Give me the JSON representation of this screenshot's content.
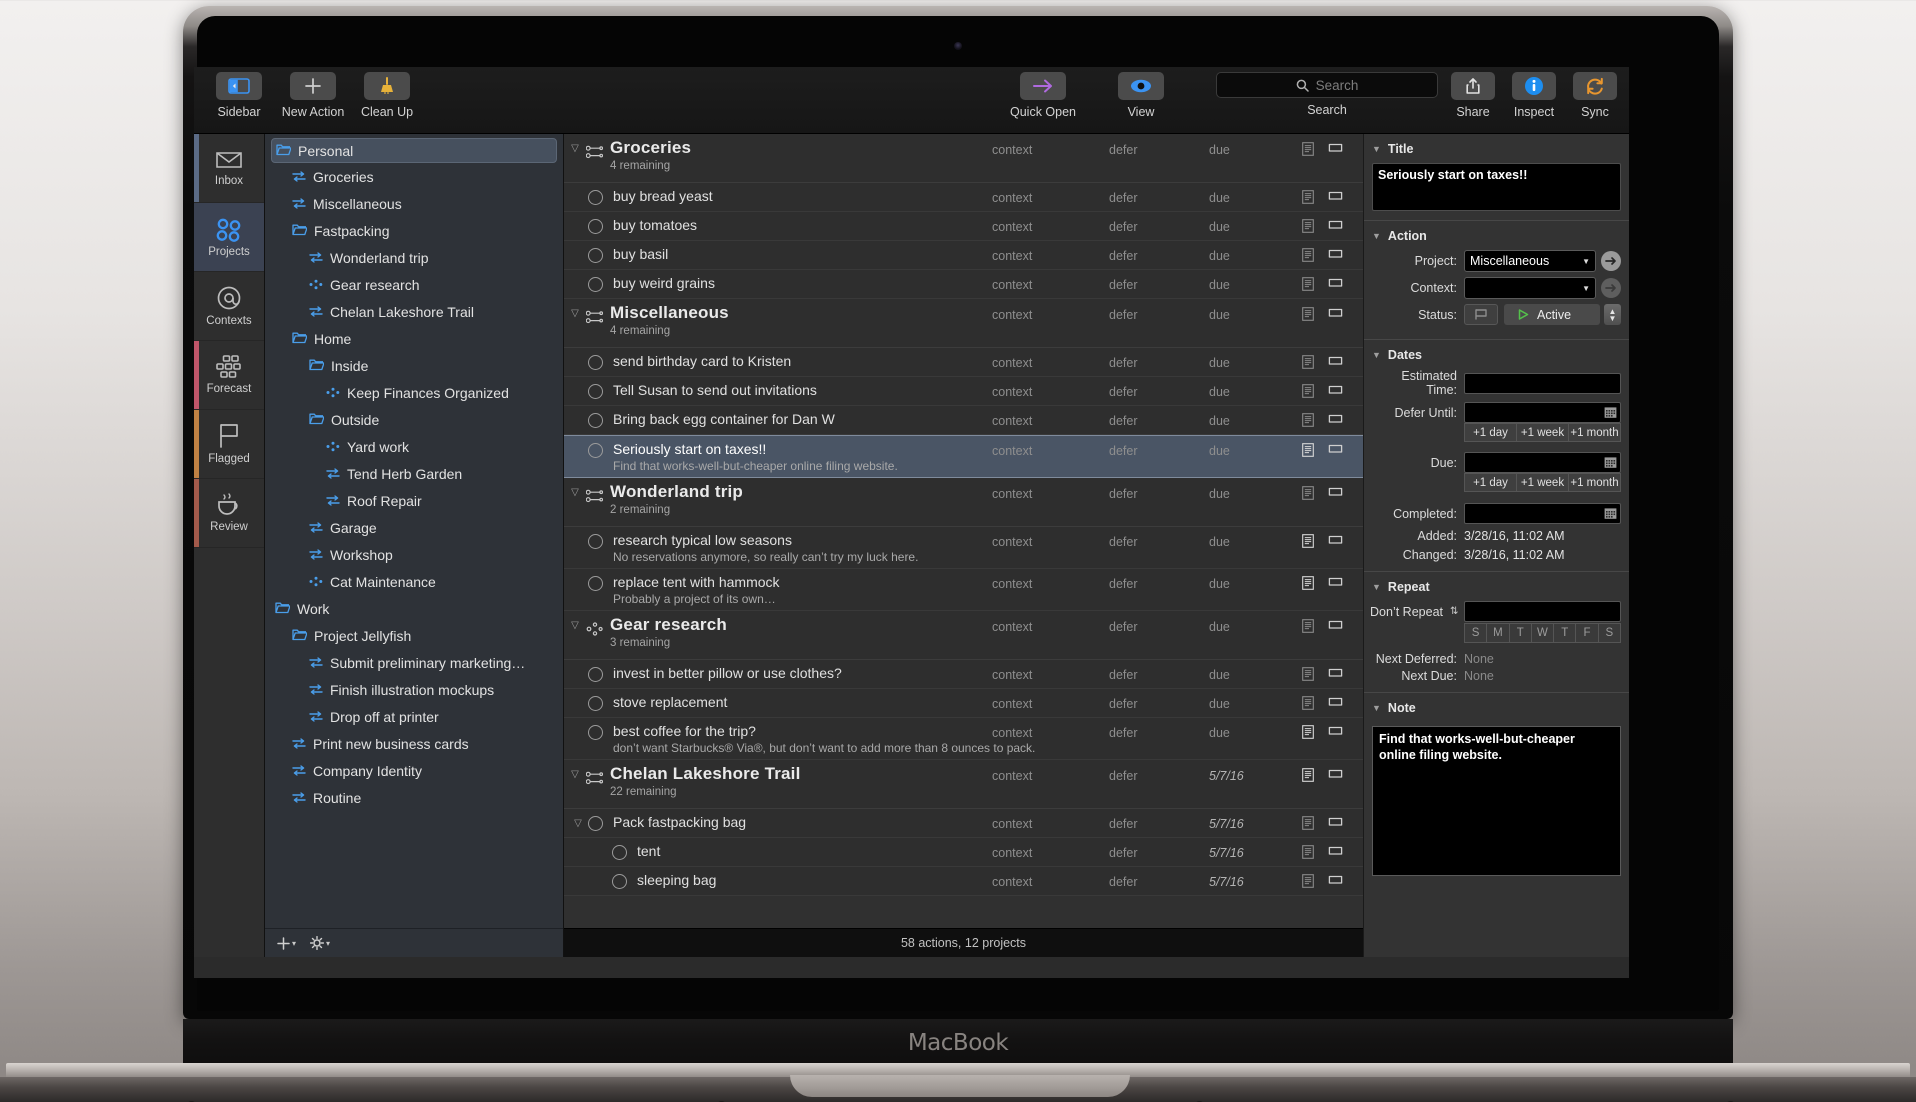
{
  "device": {
    "brand": "MacBook"
  },
  "toolbar": {
    "left": [
      {
        "label": "Sidebar",
        "icon": "sidebar-icon"
      },
      {
        "label": "New Action",
        "icon": "plus-icon"
      },
      {
        "label": "Clean Up",
        "icon": "broom-icon"
      }
    ],
    "middle": [
      {
        "label": "Quick Open",
        "icon": "arrow-right-icon"
      },
      {
        "label": "View",
        "icon": "eye-icon"
      }
    ],
    "search": {
      "label": "Search",
      "placeholder": "Search",
      "value": ""
    },
    "right": [
      {
        "label": "Share",
        "icon": "share-icon"
      },
      {
        "label": "Inspect",
        "icon": "info-icon"
      },
      {
        "label": "Sync",
        "icon": "sync-icon"
      }
    ]
  },
  "rail": {
    "items": [
      {
        "label": "Inbox",
        "icon": "inbox-icon",
        "selected": false,
        "stripe": "#5b6b86"
      },
      {
        "label": "Projects",
        "icon": "projects-icon",
        "selected": true,
        "stripe": "#2e2e2e"
      },
      {
        "label": "Contexts",
        "icon": "at-icon",
        "selected": false,
        "stripe": "#2e2e2e"
      },
      {
        "label": "Forecast",
        "icon": "calendar-grid-icon",
        "selected": false,
        "stripe": "#c0566a"
      },
      {
        "label": "Flagged",
        "icon": "flag-icon",
        "selected": false,
        "stripe": "#c08143"
      },
      {
        "label": "Review",
        "icon": "coffee-cup-icon",
        "selected": false,
        "stripe": "#a35a4b"
      }
    ]
  },
  "sidebar": {
    "items": [
      {
        "label": "Personal",
        "icon": "folder-icon",
        "depth": 0,
        "selected": true
      },
      {
        "label": "Groceries",
        "icon": "parallel-project-icon",
        "depth": 1,
        "selected": false
      },
      {
        "label": "Miscellaneous",
        "icon": "parallel-project-icon",
        "depth": 1,
        "selected": false
      },
      {
        "label": "Fastpacking",
        "icon": "folder-icon",
        "depth": 1,
        "selected": false
      },
      {
        "label": "Wonderland trip",
        "icon": "parallel-project-icon",
        "depth": 2,
        "selected": false
      },
      {
        "label": "Gear research",
        "icon": "single-action-icon",
        "depth": 2,
        "selected": false
      },
      {
        "label": "Chelan Lakeshore Trail",
        "icon": "parallel-project-icon",
        "depth": 2,
        "selected": false
      },
      {
        "label": "Home",
        "icon": "folder-icon",
        "depth": 1,
        "selected": false
      },
      {
        "label": "Inside",
        "icon": "folder-icon",
        "depth": 2,
        "selected": false
      },
      {
        "label": "Keep Finances Organized",
        "icon": "single-action-icon",
        "depth": 3,
        "selected": false
      },
      {
        "label": "Outside",
        "icon": "folder-icon",
        "depth": 2,
        "selected": false
      },
      {
        "label": "Yard work",
        "icon": "single-action-icon",
        "depth": 3,
        "selected": false
      },
      {
        "label": "Tend Herb Garden",
        "icon": "parallel-project-icon",
        "depth": 3,
        "selected": false
      },
      {
        "label": "Roof Repair",
        "icon": "parallel-project-icon",
        "depth": 3,
        "selected": false
      },
      {
        "label": "Garage",
        "icon": "parallel-project-icon",
        "depth": 2,
        "selected": false
      },
      {
        "label": "Workshop",
        "icon": "parallel-project-icon",
        "depth": 2,
        "selected": false
      },
      {
        "label": "Cat Maintenance",
        "icon": "single-action-icon",
        "depth": 2,
        "selected": false
      },
      {
        "label": "Work",
        "icon": "folder-icon",
        "depth": 0,
        "selected": false
      },
      {
        "label": "Project Jellyfish",
        "icon": "folder-icon",
        "depth": 1,
        "selected": false
      },
      {
        "label": "Submit preliminary marketing…",
        "icon": "parallel-project-icon",
        "depth": 2,
        "selected": false
      },
      {
        "label": "Finish illustration mockups",
        "icon": "parallel-project-icon",
        "depth": 2,
        "selected": false
      },
      {
        "label": "Drop off at printer",
        "icon": "parallel-project-icon",
        "depth": 2,
        "selected": false
      },
      {
        "label": "Print new business cards",
        "icon": "parallel-project-icon",
        "depth": 1,
        "selected": false
      },
      {
        "label": "Company Identity",
        "icon": "parallel-project-icon",
        "depth": 1,
        "selected": false
      },
      {
        "label": "Routine",
        "icon": "parallel-project-icon",
        "depth": 1,
        "selected": false
      }
    ],
    "footer": {
      "add": "+",
      "gear": "gear-icon"
    }
  },
  "outline": {
    "columns": {
      "context": "context",
      "defer": "defer",
      "due": "due"
    },
    "rows": [
      {
        "kind": "group",
        "title": "Groceries",
        "sub": "4 remaining",
        "icon": "parallel-project-icon",
        "context": "context",
        "defer": "defer",
        "due": "due",
        "dated": false
      },
      {
        "kind": "task",
        "title": "buy bread yeast",
        "note": "",
        "indent": 0,
        "context": "context",
        "defer": "defer",
        "due": "due",
        "dated": false
      },
      {
        "kind": "task",
        "title": "buy tomatoes",
        "note": "",
        "indent": 0,
        "context": "context",
        "defer": "defer",
        "due": "due",
        "dated": false
      },
      {
        "kind": "task",
        "title": "buy basil",
        "note": "",
        "indent": 0,
        "context": "context",
        "defer": "defer",
        "due": "due",
        "dated": false
      },
      {
        "kind": "task",
        "title": "buy weird grains",
        "note": "",
        "indent": 0,
        "context": "context",
        "defer": "defer",
        "due": "due",
        "dated": false
      },
      {
        "kind": "group",
        "title": "Miscellaneous",
        "sub": "4 remaining",
        "icon": "parallel-project-icon",
        "context": "context",
        "defer": "defer",
        "due": "due",
        "dated": false
      },
      {
        "kind": "task",
        "title": "send birthday card to Kristen",
        "note": "",
        "indent": 0,
        "context": "context",
        "defer": "defer",
        "due": "due",
        "dated": false
      },
      {
        "kind": "task",
        "title": "Tell Susan to send out invitations",
        "note": "",
        "indent": 0,
        "context": "context",
        "defer": "defer",
        "due": "due",
        "dated": false
      },
      {
        "kind": "task",
        "title": "Bring back egg container for Dan W",
        "note": "",
        "indent": 0,
        "context": "context",
        "defer": "defer",
        "due": "due",
        "dated": false
      },
      {
        "kind": "task",
        "title": "Seriously start on taxes!!",
        "note": "Find that works-well-but-cheaper online filing website.",
        "indent": 0,
        "context": "context",
        "defer": "defer",
        "due": "due",
        "dated": false,
        "selected": true
      },
      {
        "kind": "group",
        "title": "Wonderland trip",
        "sub": "2 remaining",
        "icon": "parallel-project-icon",
        "context": "context",
        "defer": "defer",
        "due": "due",
        "dated": false
      },
      {
        "kind": "task",
        "title": "research typical low seasons",
        "note": "No reservations anymore, so really can’t try my luck here.",
        "indent": 0,
        "context": "context",
        "defer": "defer",
        "due": "due",
        "dated": false
      },
      {
        "kind": "task",
        "title": "replace tent with hammock",
        "note": "Probably a project of its own…",
        "indent": 0,
        "context": "context",
        "defer": "defer",
        "due": "due",
        "dated": false
      },
      {
        "kind": "group",
        "title": "Gear research",
        "sub": "3 remaining",
        "icon": "single-action-icon",
        "context": "context",
        "defer": "defer",
        "due": "due",
        "dated": false
      },
      {
        "kind": "task",
        "title": "invest in better pillow or use clothes?",
        "note": "",
        "indent": 0,
        "context": "context",
        "defer": "defer",
        "due": "due",
        "dated": false
      },
      {
        "kind": "task",
        "title": "stove replacement",
        "note": "",
        "indent": 0,
        "context": "context",
        "defer": "defer",
        "due": "due",
        "dated": false
      },
      {
        "kind": "task",
        "title": "best coffee for the trip?",
        "note": "don’t want Starbucks® Via®, but don’t want to add more than 8 ounces to pack.",
        "indent": 0,
        "context": "context",
        "defer": "defer",
        "due": "due",
        "dated": false
      },
      {
        "kind": "group",
        "title": "Chelan Lakeshore Trail",
        "sub": "22 remaining",
        "icon": "parallel-project-icon",
        "context": "context",
        "defer": "defer",
        "due": "5/7/16",
        "dated": true
      },
      {
        "kind": "task",
        "title": "Pack fastpacking bag",
        "note": "",
        "indent": 0,
        "twisty": true,
        "context": "context",
        "defer": "defer",
        "due": "5/7/16",
        "dated": true
      },
      {
        "kind": "task",
        "title": "tent",
        "note": "",
        "indent": 1,
        "context": "context",
        "defer": "defer",
        "due": "5/7/16",
        "dated": true
      },
      {
        "kind": "task",
        "title": "sleeping bag",
        "note": "",
        "indent": 1,
        "context": "context",
        "defer": "defer",
        "due": "5/7/16",
        "dated": true
      }
    ]
  },
  "statusbar": {
    "text": "58 actions, 12 projects"
  },
  "inspector": {
    "title_section": {
      "header": "Title",
      "value": "Seriously start on taxes!!"
    },
    "action_section": {
      "header": "Action",
      "project_label": "Project:",
      "project_value": "Miscellaneous",
      "context_label": "Context:",
      "context_value": "",
      "status_label": "Status:",
      "status_value": "Active"
    },
    "dates_section": {
      "header": "Dates",
      "estimated_label": "Estimated Time:",
      "estimated_value": "",
      "defer_label": "Defer Until:",
      "defer_value": "",
      "due_label": "Due:",
      "due_value": "",
      "completed_label": "Completed:",
      "completed_value": "",
      "quick": [
        "+1 day",
        "+1 week",
        "+1 month"
      ],
      "added_label": "Added:",
      "added_value": "3/28/16, 11:02 AM",
      "changed_label": "Changed:",
      "changed_value": "3/28/16, 11:02 AM"
    },
    "repeat_section": {
      "header": "Repeat",
      "mode": "Don’t Repeat",
      "value": "",
      "days": [
        "S",
        "M",
        "T",
        "W",
        "T",
        "F",
        "S"
      ],
      "next_deferred_label": "Next Deferred:",
      "next_deferred_value": "None",
      "next_due_label": "Next Due:",
      "next_due_value": "None"
    },
    "note_section": {
      "header": "Note",
      "value": "Find that works-well-but-cheaper online filing website."
    }
  },
  "colors": {
    "accent_blue": "#3b93f2",
    "folder_blue": "#4a9eea",
    "purple": "#b06ae0",
    "orange": "#e8962f",
    "green": "#54c14b",
    "selection": "#4a5565"
  }
}
